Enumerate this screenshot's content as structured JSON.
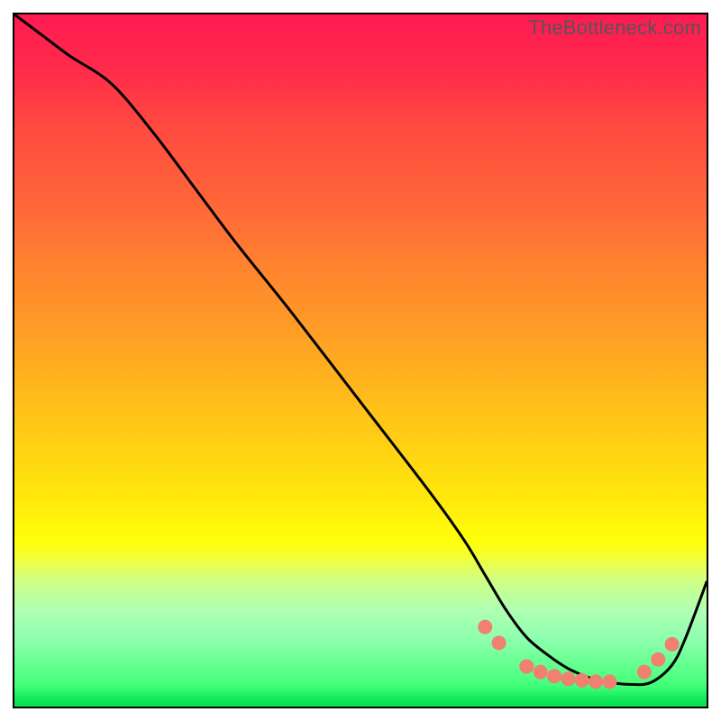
{
  "watermark": "TheBottleneck.com",
  "chart_data": {
    "type": "line",
    "title": "",
    "xlabel": "",
    "ylabel": "",
    "xlim": [
      0,
      100
    ],
    "ylim": [
      0,
      100
    ],
    "curve": {
      "name": "bottleneck-curve",
      "color": "#000000",
      "x": [
        0,
        4,
        8,
        14,
        20,
        26,
        32,
        40,
        50,
        60,
        65,
        68,
        71,
        74,
        77,
        80,
        83,
        86,
        89,
        92,
        95,
        97,
        100
      ],
      "y": [
        100,
        97,
        94,
        90,
        83,
        75,
        67,
        57,
        44,
        31,
        24,
        19,
        14,
        10,
        7.5,
        5.5,
        4.2,
        3.5,
        3.2,
        3.5,
        6,
        10,
        18
      ]
    },
    "markers": {
      "name": "dots",
      "color": "#f08070",
      "radius": 8,
      "points": [
        {
          "x": 68,
          "y": 11.5
        },
        {
          "x": 70,
          "y": 9.2
        },
        {
          "x": 74,
          "y": 5.8
        },
        {
          "x": 76,
          "y": 5.0
        },
        {
          "x": 78,
          "y": 4.4
        },
        {
          "x": 80,
          "y": 4.0
        },
        {
          "x": 82,
          "y": 3.8
        },
        {
          "x": 84,
          "y": 3.6
        },
        {
          "x": 86,
          "y": 3.6
        },
        {
          "x": 91,
          "y": 5.0
        },
        {
          "x": 93,
          "y": 6.8
        },
        {
          "x": 95,
          "y": 9.0
        }
      ]
    }
  }
}
